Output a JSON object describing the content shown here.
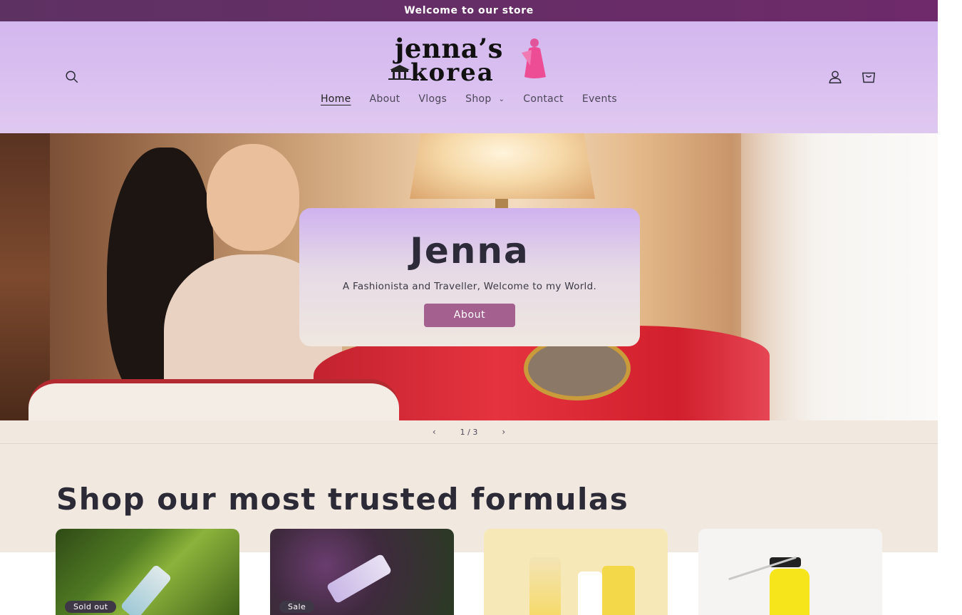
{
  "announcement": {
    "text": "Welcome to our store"
  },
  "header": {
    "logo": {
      "line1": "jenna’s",
      "line2": "korea"
    },
    "icons": {
      "search": "search-icon",
      "account": "user-icon",
      "cart": "cart-icon"
    },
    "nav": [
      {
        "label": "Home"
      },
      {
        "label": "About"
      },
      {
        "label": "Vlogs"
      },
      {
        "label": "Shop"
      },
      {
        "label": "Contact"
      },
      {
        "label": "Events"
      }
    ]
  },
  "hero": {
    "title": "Jenna",
    "subtitle": "A Fashionista and Traveller, Welcome to my World.",
    "button": "About"
  },
  "slider": {
    "prev": "‹",
    "counter": "1 / 3",
    "next": "›"
  },
  "products": {
    "title": "Shop our most trusted formulas",
    "items": [
      {
        "badge": "Sold out"
      },
      {
        "badge": "Sale"
      },
      {
        "badge": ""
      },
      {
        "badge": ""
      }
    ]
  },
  "colors": {
    "announcement_bg": "#5e3163",
    "header_bg": "#d3b7ef",
    "button_bg": "#a4608f",
    "page_bg": "#f1e9df"
  }
}
